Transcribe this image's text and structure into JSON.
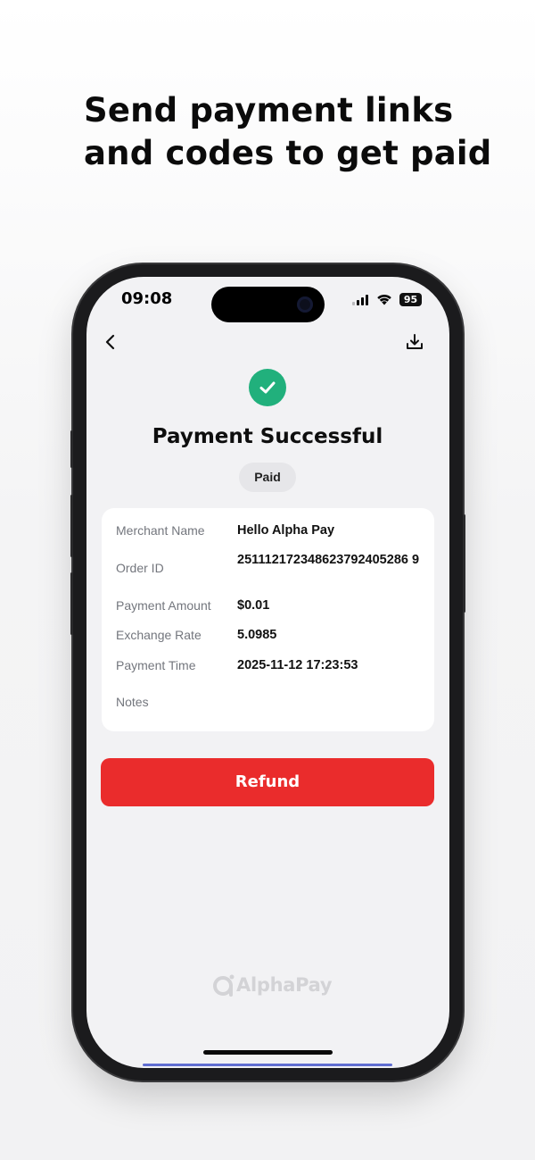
{
  "headline": {
    "line1": "Send payment links",
    "line2": "and codes to get paid"
  },
  "status_bar": {
    "time": "09:08",
    "battery": "95",
    "icons": [
      "signal-icon",
      "wifi-icon",
      "battery-icon"
    ]
  },
  "nav": {
    "back_icon": "chevron-left-icon",
    "download_icon": "download-icon"
  },
  "result": {
    "icon": "check-circle-icon",
    "title": "Payment Successful",
    "status_badge": "Paid"
  },
  "details": [
    {
      "label": "Merchant Name",
      "value": "Hello Alpha Pay"
    },
    {
      "label": "Order ID",
      "value": "251112172348623792405286 9"
    },
    {
      "label": "Payment Amount",
      "value": "$0.01"
    },
    {
      "label": "Exchange Rate",
      "value": "5.0985"
    },
    {
      "label": "Payment Time",
      "value": "2025-11-12 17:23:53"
    },
    {
      "label": "Notes",
      "value": ""
    }
  ],
  "actions": {
    "refund_label": "Refund"
  },
  "brand": {
    "name": "AlphaPay"
  },
  "colors": {
    "success": "#21b07c",
    "refund_button": "#ea2c2c",
    "badge_bg": "#e6e6e9",
    "screen_bg": "#f2f2f4"
  }
}
